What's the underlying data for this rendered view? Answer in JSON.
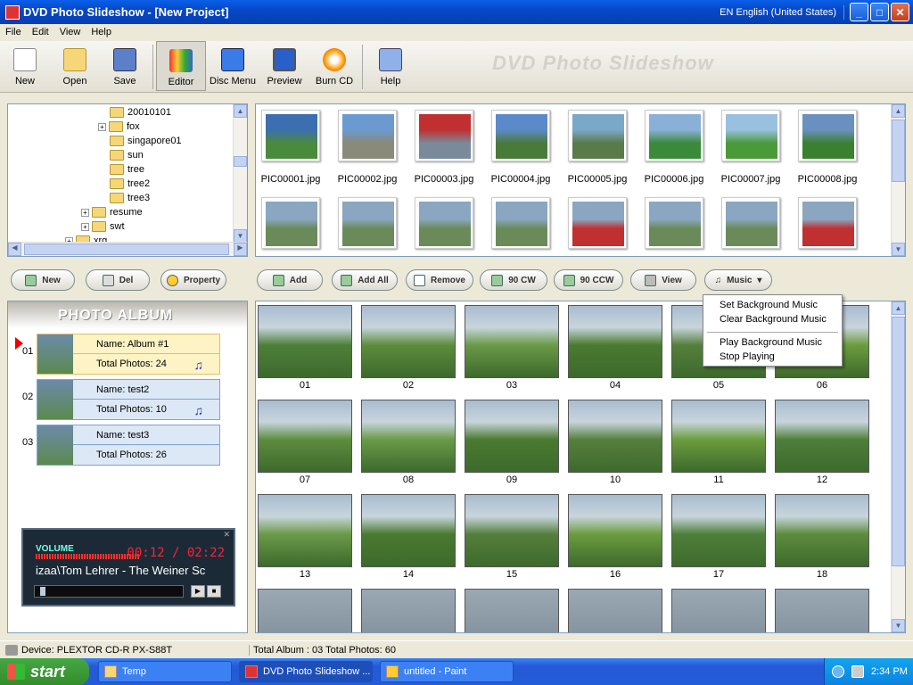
{
  "window": {
    "title": "DVD Photo Slideshow - [New Project]",
    "lang": "EN English (United States)"
  },
  "menu": [
    "File",
    "Edit",
    "View",
    "Help"
  ],
  "toolbar": [
    {
      "label": "New",
      "icon": "new-doc-icon"
    },
    {
      "label": "Open",
      "icon": "open-folder-icon"
    },
    {
      "label": "Save",
      "icon": "save-disk-icon"
    },
    {
      "label": "Editor",
      "icon": "editor-icon",
      "active": true
    },
    {
      "label": "Disc Menu",
      "icon": "disc-menu-icon"
    },
    {
      "label": "Preview",
      "icon": "monitor-icon"
    },
    {
      "label": "Burn CD",
      "icon": "burn-cd-icon"
    },
    {
      "label": "Help",
      "icon": "help-icon"
    }
  ],
  "watermark": "DVD Photo Slideshow",
  "tree": [
    {
      "label": "20010101",
      "expandable": false
    },
    {
      "label": "fox",
      "expandable": true
    },
    {
      "label": "singapore01",
      "expandable": false
    },
    {
      "label": "sun",
      "expandable": false
    },
    {
      "label": "tree",
      "expandable": false
    },
    {
      "label": "tree2",
      "expandable": false
    },
    {
      "label": "tree3",
      "expandable": false
    },
    {
      "label": "resume",
      "expandable": true
    },
    {
      "label": "swt",
      "expandable": true
    },
    {
      "label": "xrg",
      "expandable": true
    }
  ],
  "files": [
    "PIC00001.jpg",
    "PIC00002.jpg",
    "PIC00003.jpg",
    "PIC00004.jpg",
    "PIC00005.jpg",
    "PIC00006.jpg",
    "PIC00007.jpg",
    "PIC00008.jpg"
  ],
  "file_buttons": {
    "new": "New",
    "del": "Del",
    "property": "Property"
  },
  "photo_buttons": {
    "add": "Add",
    "add_all": "Add All",
    "remove": "Remove",
    "cw": "90 CW",
    "ccw": "90 CCW",
    "view": "View",
    "music": "Music"
  },
  "album_panel_title": "PHOTO ALBUM",
  "albums": [
    {
      "num": "01",
      "name": "Name: Album #1",
      "total": "Total Photos: 24",
      "music": true,
      "selected": true
    },
    {
      "num": "02",
      "name": "Name: test2",
      "total": "Total Photos: 10",
      "music": true,
      "selected": false
    },
    {
      "num": "03",
      "name": "Name: test3",
      "total": "Total Photos: 26",
      "music": false,
      "selected": false
    }
  ],
  "player": {
    "volume_label": "VOLUME",
    "time": "00:12 / 02:22",
    "track": "izaa\\Tom Lehrer - The Weiner Sc"
  },
  "photos": [
    "01",
    "02",
    "03",
    "04",
    "05",
    "06",
    "07",
    "08",
    "09",
    "10",
    "11",
    "12",
    "13",
    "14",
    "15",
    "16",
    "17",
    "18"
  ],
  "music_menu": {
    "set": "Set Background Music",
    "clear": "Clear Background Music",
    "play": "Play Background Music",
    "stop": "Stop Playing"
  },
  "status": {
    "device": "Device: PLEXTOR   CD-R   PX-S88T",
    "totals": "Total Album : 03  Total Photos: 60"
  },
  "taskbar": {
    "start": "start",
    "tasks": [
      "Temp",
      "DVD Photo Slideshow ...",
      "untitled - Paint"
    ],
    "time": "2:34 PM"
  },
  "colors": {
    "titlebar": "#0a5fe8",
    "album_selected": "#fdf3c4",
    "album_normal": "#dde8f6",
    "accent": "#2233cc"
  }
}
